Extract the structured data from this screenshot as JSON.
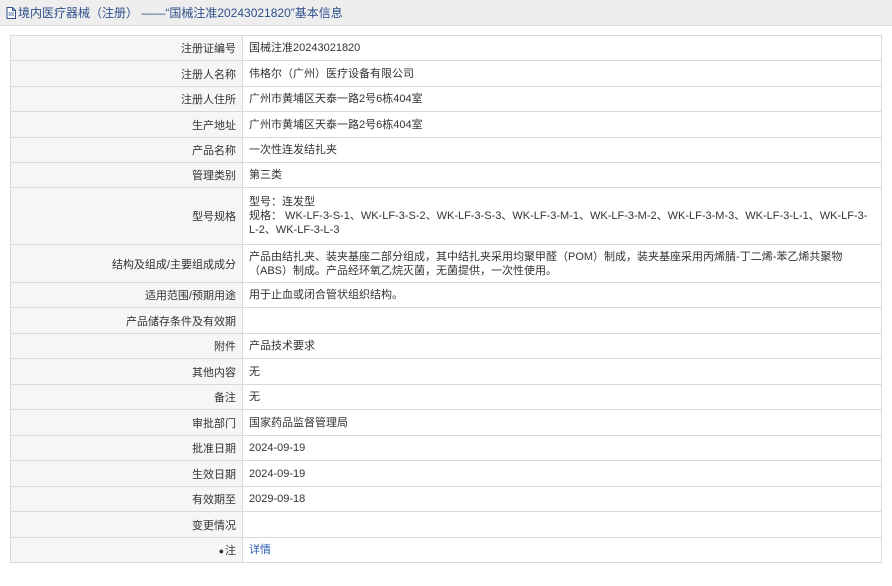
{
  "header": {
    "title": "境内医疗器械（注册） ——“国械注准20243021820”基本信息"
  },
  "rows": [
    {
      "key": "注册证编号",
      "value": "国械注准20243021820"
    },
    {
      "key": "注册人名称",
      "value": "伟格尔（广州）医疗设备有限公司"
    },
    {
      "key": "注册人住所",
      "value": "广州市黄埔区天泰一路2号6栋404室"
    },
    {
      "key": "生产地址",
      "value": "广州市黄埔区天泰一路2号6栋404室"
    },
    {
      "key": "产品名称",
      "value": "一次性连发结扎夹"
    },
    {
      "key": "管理类别",
      "value": "第三类"
    },
    {
      "key": "型号规格",
      "value_line1": "型号：连发型",
      "value_line2": "规格：  WK-LF-3-S-1、WK-LF-3-S-2、WK-LF-3-S-3、WK-LF-3-M-1、WK-LF-3-M-2、WK-LF-3-M-3、WK-LF-3-L-1、WK-LF-3-L-2、WK-LF-3-L-3"
    },
    {
      "key": "结构及组成/主要组成成分",
      "value": "产品由结扎夹、装夹基座二部分组成，其中结扎夹采用均聚甲醛（POM）制成，装夹基座采用丙烯腈-丁二烯-苯乙烯共聚物（ABS）制成。产品经环氧乙烷灭菌，无菌提供，一次性使用。"
    },
    {
      "key": "适用范围/预期用途",
      "value": "用于止血或闭合管状组织结构。"
    },
    {
      "key": "产品储存条件及有效期",
      "value": ""
    },
    {
      "key": "附件",
      "value": "产品技术要求"
    },
    {
      "key": "其他内容",
      "value": "无"
    },
    {
      "key": "备注",
      "value": "无"
    },
    {
      "key": "审批部门",
      "value": "国家药品监督管理局"
    },
    {
      "key": "批准日期",
      "value": "2024-09-19"
    },
    {
      "key": "生效日期",
      "value": "2024-09-19"
    },
    {
      "key": "有效期至",
      "value": "2029-09-18"
    },
    {
      "key": "变更情况",
      "value": ""
    },
    {
      "key": "注",
      "value": "详情",
      "key_prefix": "●"
    }
  ]
}
